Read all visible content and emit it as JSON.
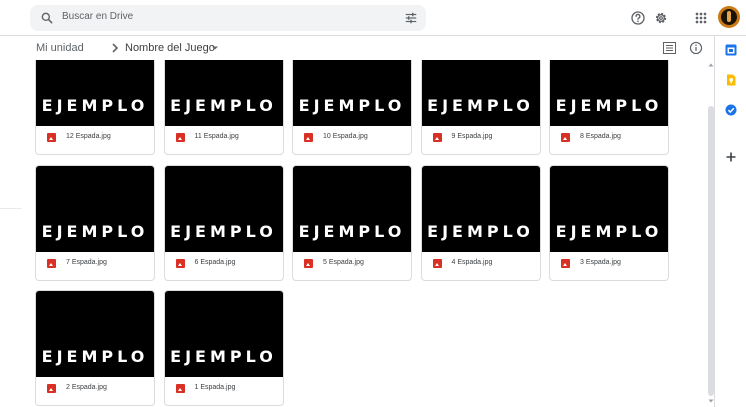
{
  "search": {
    "placeholder": "Buscar en Drive",
    "search_icon": "search-icon",
    "filter_icon": "tune-icon"
  },
  "header_icons": [
    "help-icon",
    "settings-icon",
    "apps-grid-icon",
    "account-avatar"
  ],
  "breadcrumb": {
    "root": "Mi unidad",
    "current": "Nombre del Juego"
  },
  "view_icons": [
    "list-view-icon",
    "info-icon"
  ],
  "files": [
    {
      "name": "12 Espada.jpg",
      "thumb_text": "EJEMPLO"
    },
    {
      "name": "11 Espada.jpg",
      "thumb_text": "EJEMPLO"
    },
    {
      "name": "10 Espada.jpg",
      "thumb_text": "EJEMPLO"
    },
    {
      "name": "9 Espada.jpg",
      "thumb_text": "EJEMPLO"
    },
    {
      "name": "8 Espada.jpg",
      "thumb_text": "EJEMPLO"
    },
    {
      "name": "7 Espada.jpg",
      "thumb_text": "EJEMPLO"
    },
    {
      "name": "6 Espada.jpg",
      "thumb_text": "EJEMPLO"
    },
    {
      "name": "5 Espada.jpg",
      "thumb_text": "EJEMPLO"
    },
    {
      "name": "4 Espada.jpg",
      "thumb_text": "EJEMPLO"
    },
    {
      "name": "3 Espada.jpg",
      "thumb_text": "EJEMPLO"
    },
    {
      "name": "2 Espada.jpg",
      "thumb_text": "EJEMPLO"
    },
    {
      "name": "1 Espada.jpg",
      "thumb_text": "EJEMPLO"
    }
  ],
  "side_panel": [
    {
      "name": "calendar-icon",
      "color": "#1a73e8"
    },
    {
      "name": "keep-icon",
      "color": "#fbbc04"
    },
    {
      "name": "tasks-icon",
      "color": "#1a73e8"
    },
    {
      "name": "add-icon",
      "color": "#3c4043"
    }
  ],
  "colors": {
    "image_file_icon": "#d93025",
    "thumbnail_bg": "#000000",
    "thumbnail_text": "#ffffff"
  }
}
